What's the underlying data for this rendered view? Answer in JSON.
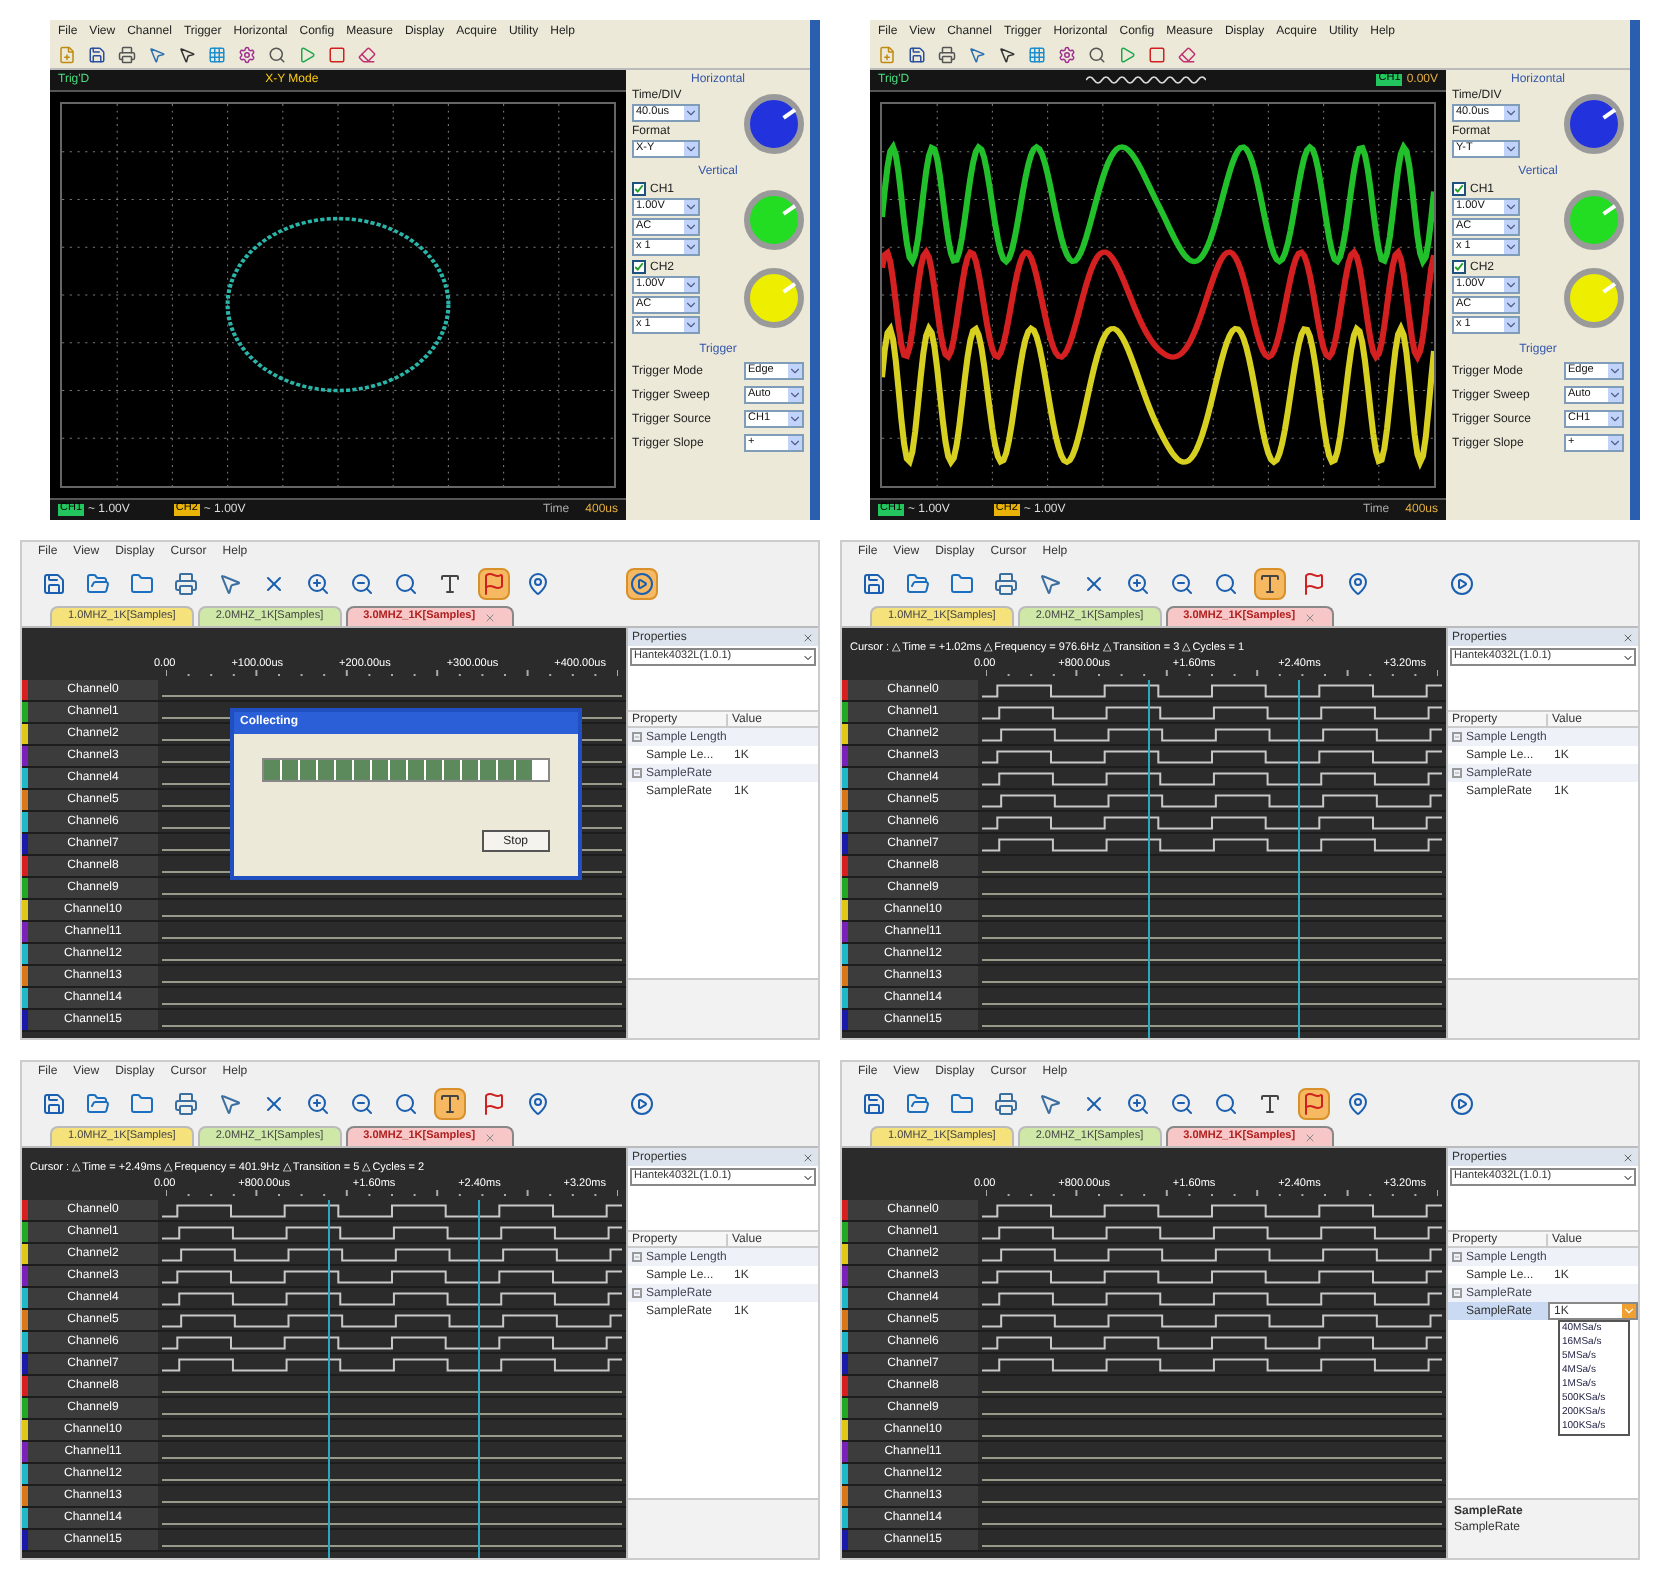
{
  "panels": [
    {
      "kind": "scope",
      "menu": [
        "File",
        "View",
        "Channel",
        "Trigger",
        "Horizontal",
        "Config",
        "Measure",
        "Display",
        "Acquire",
        "Utility",
        "Help"
      ],
      "status": "Trig'D",
      "mode_label": "X-Y Mode",
      "screen": {
        "kind": "xy"
      },
      "bottom": [
        {
          "badge": "CH1",
          "text": "~ 1.00V",
          "color": "#22c55e"
        },
        {
          "badge": "CH2",
          "text": "~ 1.00V",
          "color": "#eab308"
        }
      ],
      "time_label": "Time",
      "time_value": "400us",
      "horizontal": {
        "title": "Horizontal",
        "color": "#2233dd",
        "fields": [
          {
            "label": "Time/DIV",
            "value": "40.0us"
          },
          {
            "label": "Format",
            "value": "X-Y"
          }
        ]
      },
      "vertical": {
        "title": "Vertical",
        "channels": [
          {
            "label": "CH1",
            "checked": true,
            "color": "#22dd22",
            "values": [
              "1.00V",
              "AC",
              "x 1"
            ]
          },
          {
            "label": "CH2",
            "checked": true,
            "color": "#eeee00",
            "values": [
              "1.00V",
              "AC",
              "x 1"
            ]
          }
        ]
      },
      "trigger": {
        "title": "Trigger",
        "rows": [
          {
            "label": "Trigger Mode",
            "value": "Edge"
          },
          {
            "label": "Trigger Sweep",
            "value": "Auto"
          },
          {
            "label": "Trigger Source",
            "value": "CH1"
          },
          {
            "label": "Trigger Slope",
            "value": "+"
          }
        ]
      }
    },
    {
      "kind": "scope",
      "menu": [
        "File",
        "View",
        "Channel",
        "Trigger",
        "Horizontal",
        "Config",
        "Measure",
        "Display",
        "Acquire",
        "Utility",
        "Help"
      ],
      "status": "Trig'D",
      "screen": {
        "kind": "yt"
      },
      "trigger_readout": {
        "badge": "CH1",
        "text": "0.00V"
      },
      "bottom": [
        {
          "badge": "CH1",
          "text": "~ 1.00V",
          "color": "#22c55e"
        },
        {
          "badge": "CH2",
          "text": "~ 1.00V",
          "color": "#eab308"
        }
      ],
      "time_label": "Time",
      "time_value": "400us",
      "horizontal": {
        "title": "Horizontal",
        "color": "#2233dd",
        "fields": [
          {
            "label": "Time/DIV",
            "value": "40.0us"
          },
          {
            "label": "Format",
            "value": "Y-T"
          }
        ]
      },
      "vertical": {
        "title": "Vertical",
        "channels": [
          {
            "label": "CH1",
            "checked": true,
            "color": "#22dd22",
            "values": [
              "1.00V",
              "AC",
              "x 1"
            ]
          },
          {
            "label": "CH2",
            "checked": true,
            "color": "#eeee00",
            "values": [
              "1.00V",
              "AC",
              "x 1"
            ]
          }
        ]
      },
      "trigger": {
        "title": "Trigger",
        "rows": [
          {
            "label": "Trigger Mode",
            "value": "Edge"
          },
          {
            "label": "Trigger Sweep",
            "value": "Auto"
          },
          {
            "label": "Trigger Source",
            "value": "CH1"
          },
          {
            "label": "Trigger Slope",
            "value": "+"
          }
        ]
      }
    },
    {
      "kind": "logic",
      "menu": [
        "File",
        "View",
        "Display",
        "Cursor",
        "Help"
      ],
      "toolbar": [
        {
          "kind": "save",
          "selected": false
        },
        {
          "kind": "open",
          "selected": false
        },
        {
          "kind": "folder",
          "selected": false
        },
        {
          "kind": "print",
          "selected": false
        },
        {
          "kind": "pointer",
          "selected": false
        },
        {
          "kind": "delete",
          "selected": false
        },
        {
          "kind": "zoom-in",
          "selected": false
        },
        {
          "kind": "zoom-out",
          "selected": false
        },
        {
          "kind": "zoom",
          "selected": false
        },
        {
          "kind": "cursor",
          "selected": false
        },
        {
          "kind": "marker",
          "selected": true
        },
        {
          "kind": "pin",
          "selected": false
        },
        {
          "kind": "run",
          "selected": true
        }
      ],
      "tabs": [
        {
          "label": "1.0MHZ_1K[Samples]",
          "selected": false,
          "color": "#f5e27a"
        },
        {
          "label": "2.0MHZ_1K[Samples]",
          "selected": false,
          "color": "#cfe8a8"
        },
        {
          "label": "3.0MHZ_1K[Samples]",
          "selected": true,
          "color": "#f7c6c6"
        }
      ],
      "ruler": [
        "0.00",
        "+100.00us",
        "+200.00us",
        "+300.00us",
        "+400.00us"
      ],
      "channels": [
        {
          "name": "Channel0",
          "color": "#d42020",
          "active": false
        },
        {
          "name": "Channel1",
          "color": "#22a822",
          "active": false
        },
        {
          "name": "Channel2",
          "color": "#e0c81a",
          "active": false
        },
        {
          "name": "Channel3",
          "color": "#7a22b8",
          "active": false
        },
        {
          "name": "Channel4",
          "color": "#1fb8c8",
          "active": false
        },
        {
          "name": "Channel5",
          "color": "#d9781a",
          "active": false
        },
        {
          "name": "Channel6",
          "color": "#1fb8c8",
          "active": false
        },
        {
          "name": "Channel7",
          "color": "#1a1aa8",
          "active": false
        },
        {
          "name": "Channel8",
          "color": "#d42020",
          "active": false
        },
        {
          "name": "Channel9",
          "color": "#22a822",
          "active": false
        },
        {
          "name": "Channel10",
          "color": "#e0c81a",
          "active": false
        },
        {
          "name": "Channel11",
          "color": "#7a22b8",
          "active": false
        },
        {
          "name": "Channel12",
          "color": "#1fb8c8",
          "active": false
        },
        {
          "name": "Channel13",
          "color": "#d9781a",
          "active": false
        },
        {
          "name": "Channel14",
          "color": "#1fb8c8",
          "active": false
        },
        {
          "name": "Channel15",
          "color": "#1a1aa8",
          "active": false
        }
      ],
      "dialog": {
        "title": "Collecting",
        "level": 0.95,
        "button": "Stop"
      },
      "properties": {
        "title": "Properties",
        "device": "Hantek4032L(1.0.1)",
        "headers": [
          "Property",
          "Value"
        ],
        "rows": [
          {
            "kind": "group",
            "label": "Sample Length",
            "expanded": true
          },
          {
            "kind": "item",
            "label": "Sample Le...",
            "value": "1K",
            "selected": false
          },
          {
            "kind": "group",
            "label": "SampleRate",
            "expanded": true
          },
          {
            "kind": "item",
            "label": "SampleRate",
            "value": "1K",
            "selected": false
          }
        ]
      }
    },
    {
      "kind": "logic",
      "menu": [
        "File",
        "View",
        "Display",
        "Cursor",
        "Help"
      ],
      "toolbar": [
        {
          "kind": "save",
          "selected": false
        },
        {
          "kind": "open",
          "selected": false
        },
        {
          "kind": "folder",
          "selected": false
        },
        {
          "kind": "print",
          "selected": false
        },
        {
          "kind": "pointer",
          "selected": false
        },
        {
          "kind": "delete",
          "selected": false
        },
        {
          "kind": "zoom-in",
          "selected": false
        },
        {
          "kind": "zoom-out",
          "selected": false
        },
        {
          "kind": "zoom",
          "selected": false
        },
        {
          "kind": "cursor",
          "selected": true
        },
        {
          "kind": "marker",
          "selected": false
        },
        {
          "kind": "pin",
          "selected": false
        },
        {
          "kind": "run",
          "selected": false
        }
      ],
      "tabs": [
        {
          "label": "1.0MHZ_1K[Samples]",
          "selected": false,
          "color": "#f5e27a"
        },
        {
          "label": "2.0MHZ_1K[Samples]",
          "selected": false,
          "color": "#cfe8a8"
        },
        {
          "label": "3.0MHZ_1K[Samples]",
          "selected": true,
          "color": "#f7c6c6"
        }
      ],
      "cursor_text": "Cursor : △Time = +1.02ms  △Frequency = 976.6Hz  △Transition = 3  △Cycles = 1",
      "ruler": [
        "0.00",
        "+800.00us",
        "+1.60ms",
        "+2.40ms",
        "+3.20ms"
      ],
      "channels": [
        {
          "name": "Channel0",
          "color": "#d42020",
          "active": true
        },
        {
          "name": "Channel1",
          "color": "#22a822",
          "active": true
        },
        {
          "name": "Channel2",
          "color": "#e0c81a",
          "active": true
        },
        {
          "name": "Channel3",
          "color": "#7a22b8",
          "active": true
        },
        {
          "name": "Channel4",
          "color": "#1fb8c8",
          "active": true
        },
        {
          "name": "Channel5",
          "color": "#d9781a",
          "active": true
        },
        {
          "name": "Channel6",
          "color": "#1fb8c8",
          "active": true
        },
        {
          "name": "Channel7",
          "color": "#1a1aa8",
          "active": true
        },
        {
          "name": "Channel8",
          "color": "#d42020",
          "active": false
        },
        {
          "name": "Channel9",
          "color": "#22a822",
          "active": false
        },
        {
          "name": "Channel10",
          "color": "#e0c81a",
          "active": false
        },
        {
          "name": "Channel11",
          "color": "#7a22b8",
          "active": false
        },
        {
          "name": "Channel12",
          "color": "#1fb8c8",
          "active": false
        },
        {
          "name": "Channel13",
          "color": "#d9781a",
          "active": false
        },
        {
          "name": "Channel14",
          "color": "#1fb8c8",
          "active": false
        },
        {
          "name": "Channel15",
          "color": "#1a1aa8",
          "active": false
        }
      ],
      "properties": {
        "title": "Properties",
        "device": "Hantek4032L(1.0.1)",
        "headers": [
          "Property",
          "Value"
        ],
        "rows": [
          {
            "kind": "group",
            "label": "Sample Length",
            "expanded": true
          },
          {
            "kind": "item",
            "label": "Sample Le...",
            "value": "1K",
            "selected": false
          },
          {
            "kind": "group",
            "label": "SampleRate",
            "expanded": true
          },
          {
            "kind": "item",
            "label": "SampleRate",
            "value": "1K",
            "selected": false
          }
        ]
      }
    },
    {
      "kind": "logic",
      "menu": [
        "File",
        "View",
        "Display",
        "Cursor",
        "Help"
      ],
      "toolbar": [
        {
          "kind": "save",
          "selected": false
        },
        {
          "kind": "open",
          "selected": false
        },
        {
          "kind": "folder",
          "selected": false
        },
        {
          "kind": "print",
          "selected": false
        },
        {
          "kind": "pointer",
          "selected": false
        },
        {
          "kind": "delete",
          "selected": false
        },
        {
          "kind": "zoom-in",
          "selected": false
        },
        {
          "kind": "zoom-out",
          "selected": false
        },
        {
          "kind": "zoom",
          "selected": false
        },
        {
          "kind": "cursor",
          "selected": true
        },
        {
          "kind": "marker",
          "selected": false
        },
        {
          "kind": "pin",
          "selected": false
        },
        {
          "kind": "run",
          "selected": false
        }
      ],
      "tabs": [
        {
          "label": "1.0MHZ_1K[Samples]",
          "selected": false,
          "color": "#f5e27a"
        },
        {
          "label": "2.0MHZ_1K[Samples]",
          "selected": false,
          "color": "#cfe8a8"
        },
        {
          "label": "3.0MHZ_1K[Samples]",
          "selected": true,
          "color": "#f7c6c6"
        }
      ],
      "cursor_text": "Cursor : △Time = +2.49ms  △Frequency = 401.9Hz  △Transition = 5  △Cycles = 2",
      "ruler": [
        "0.00",
        "+800.00us",
        "+1.60ms",
        "+2.40ms",
        "+3.20ms"
      ],
      "channels": [
        {
          "name": "Channel0",
          "color": "#d42020",
          "active": true
        },
        {
          "name": "Channel1",
          "color": "#22a822",
          "active": true
        },
        {
          "name": "Channel2",
          "color": "#e0c81a",
          "active": true
        },
        {
          "name": "Channel3",
          "color": "#7a22b8",
          "active": true
        },
        {
          "name": "Channel4",
          "color": "#1fb8c8",
          "active": true
        },
        {
          "name": "Channel5",
          "color": "#d9781a",
          "active": true
        },
        {
          "name": "Channel6",
          "color": "#1fb8c8",
          "active": true
        },
        {
          "name": "Channel7",
          "color": "#1a1aa8",
          "active": true
        },
        {
          "name": "Channel8",
          "color": "#d42020",
          "active": false
        },
        {
          "name": "Channel9",
          "color": "#22a822",
          "active": false
        },
        {
          "name": "Channel10",
          "color": "#e0c81a",
          "active": false
        },
        {
          "name": "Channel11",
          "color": "#7a22b8",
          "active": false
        },
        {
          "name": "Channel12",
          "color": "#1fb8c8",
          "active": false
        },
        {
          "name": "Channel13",
          "color": "#d9781a",
          "active": false
        },
        {
          "name": "Channel14",
          "color": "#1fb8c8",
          "active": false
        },
        {
          "name": "Channel15",
          "color": "#1a1aa8",
          "active": false
        }
      ],
      "properties": {
        "title": "Properties",
        "device": "Hantek4032L(1.0.1)",
        "headers": [
          "Property",
          "Value"
        ],
        "rows": [
          {
            "kind": "group",
            "label": "Sample Length",
            "expanded": true
          },
          {
            "kind": "item",
            "label": "Sample Le...",
            "value": "1K",
            "selected": false
          },
          {
            "kind": "group",
            "label": "SampleRate",
            "expanded": true
          },
          {
            "kind": "item",
            "label": "SampleRate",
            "value": "1K",
            "selected": false
          }
        ]
      }
    },
    {
      "kind": "logic",
      "menu": [
        "File",
        "View",
        "Display",
        "Cursor",
        "Help"
      ],
      "toolbar": [
        {
          "kind": "save",
          "selected": false
        },
        {
          "kind": "open",
          "selected": false
        },
        {
          "kind": "folder",
          "selected": false
        },
        {
          "kind": "print",
          "selected": false
        },
        {
          "kind": "pointer",
          "selected": false
        },
        {
          "kind": "delete",
          "selected": false
        },
        {
          "kind": "zoom-in",
          "selected": false
        },
        {
          "kind": "zoom-out",
          "selected": false
        },
        {
          "kind": "zoom",
          "selected": false
        },
        {
          "kind": "cursor",
          "selected": false
        },
        {
          "kind": "marker",
          "selected": true
        },
        {
          "kind": "pin",
          "selected": false
        },
        {
          "kind": "run",
          "selected": false
        }
      ],
      "tabs": [
        {
          "label": "1.0MHZ_1K[Samples]",
          "selected": false,
          "color": "#f5e27a"
        },
        {
          "label": "2.0MHZ_1K[Samples]",
          "selected": false,
          "color": "#cfe8a8"
        },
        {
          "label": "3.0MHZ_1K[Samples]",
          "selected": true,
          "color": "#f7c6c6"
        }
      ],
      "ruler": [
        "0.00",
        "+800.00us",
        "+1.60ms",
        "+2.40ms",
        "+3.20ms"
      ],
      "channels": [
        {
          "name": "Channel0",
          "color": "#d42020",
          "active": true
        },
        {
          "name": "Channel1",
          "color": "#22a822",
          "active": true
        },
        {
          "name": "Channel2",
          "color": "#e0c81a",
          "active": true
        },
        {
          "name": "Channel3",
          "color": "#7a22b8",
          "active": true
        },
        {
          "name": "Channel4",
          "color": "#1fb8c8",
          "active": true
        },
        {
          "name": "Channel5",
          "color": "#d9781a",
          "active": true
        },
        {
          "name": "Channel6",
          "color": "#1fb8c8",
          "active": true
        },
        {
          "name": "Channel7",
          "color": "#1a1aa8",
          "active": true
        },
        {
          "name": "Channel8",
          "color": "#d42020",
          "active": false
        },
        {
          "name": "Channel9",
          "color": "#22a822",
          "active": false
        },
        {
          "name": "Channel10",
          "color": "#e0c81a",
          "active": false
        },
        {
          "name": "Channel11",
          "color": "#7a22b8",
          "active": false
        },
        {
          "name": "Channel12",
          "color": "#1fb8c8",
          "active": false
        },
        {
          "name": "Channel13",
          "color": "#d9781a",
          "active": false
        },
        {
          "name": "Channel14",
          "color": "#1fb8c8",
          "active": false
        },
        {
          "name": "Channel15",
          "color": "#1a1aa8",
          "active": false
        }
      ],
      "properties": {
        "title": "Properties",
        "device": "Hantek4032L(1.0.1)",
        "headers": [
          "Property",
          "Value"
        ],
        "rows": [
          {
            "kind": "group",
            "label": "Sample Length",
            "expanded": true
          },
          {
            "kind": "item",
            "label": "Sample Le...",
            "value": "1K",
            "selected": false
          },
          {
            "kind": "group",
            "label": "SampleRate",
            "expanded": true
          },
          {
            "kind": "item",
            "label": "SampleRate",
            "value": "1K",
            "selected": true,
            "options": [
              "40MSa/s",
              "16MSa/s",
              "5MSa/s",
              "4MSa/s",
              "1MSa/s",
              "500KSa/s",
              "200KSa/s",
              "100KSa/s"
            ]
          }
        ],
        "help": {
          "title": "SampleRate",
          "text": "SampleRate"
        }
      }
    }
  ]
}
